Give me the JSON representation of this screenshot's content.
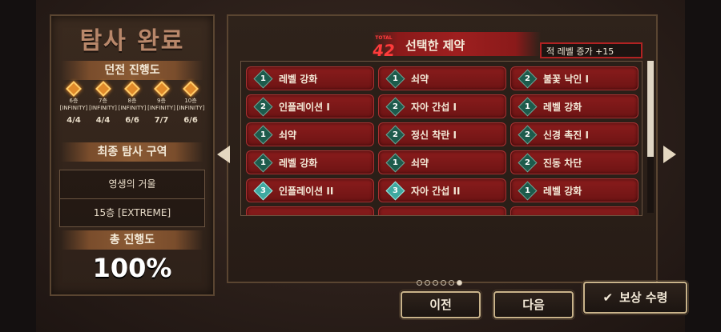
{
  "left_panel": {
    "title": "탐사 완료",
    "dungeon_progress_label": "던전 진행도",
    "floors": [
      {
        "name": "6층 [INFINITY]",
        "progress": "4/4"
      },
      {
        "name": "7층 [INFINITY]",
        "progress": "4/4"
      },
      {
        "name": "8층 [INFINITY]",
        "progress": "6/6"
      },
      {
        "name": "9층 [INFINITY]",
        "progress": "7/7"
      },
      {
        "name": "10층 [INFINITY]",
        "progress": "6/6"
      }
    ],
    "final_zone_label": "최종 탐사 구역",
    "final_zone_name": "영생의 거울",
    "final_zone_floor": "15층 [EXTREME]",
    "total_progress_label": "총 진행도",
    "total_progress_value": "100%"
  },
  "main_panel": {
    "seal_small": "TOTAL",
    "seal_number": "42",
    "title": "선택한 제약",
    "bonus_text": "적 레벨 증가 +15",
    "constraints": [
      {
        "tier": "1",
        "label": "레벨 강화"
      },
      {
        "tier": "1",
        "label": "쇠약"
      },
      {
        "tier": "2",
        "label": "불꽃 낙인 I"
      },
      {
        "tier": "2",
        "label": "인플레이션 I"
      },
      {
        "tier": "2",
        "label": "자아 간섭 I"
      },
      {
        "tier": "1",
        "label": "레벨 강화"
      },
      {
        "tier": "1",
        "label": "쇠약"
      },
      {
        "tier": "2",
        "label": "정신 착란 I"
      },
      {
        "tier": "2",
        "label": "신경 촉진 I"
      },
      {
        "tier": "1",
        "label": "레벨 강화"
      },
      {
        "tier": "1",
        "label": "쇠약"
      },
      {
        "tier": "2",
        "label": "진동 차단"
      },
      {
        "tier": "3",
        "label": "인플레이션 II"
      },
      {
        "tier": "3",
        "label": "자아 간섭 II"
      },
      {
        "tier": "1",
        "label": "레벨 강화"
      }
    ]
  },
  "pagination": {
    "total": 6,
    "active_index": 5
  },
  "buttons": {
    "prev_label": "이전",
    "next_label": "다음",
    "reward_label": "보상 수령",
    "reward_icon": "check-icon"
  },
  "colors": {
    "card_red": "#8a1c1c",
    "tier_green": "#1d5b4c",
    "tier3_teal": "#3fa8a0",
    "accent_orange": "#e08a2a"
  }
}
